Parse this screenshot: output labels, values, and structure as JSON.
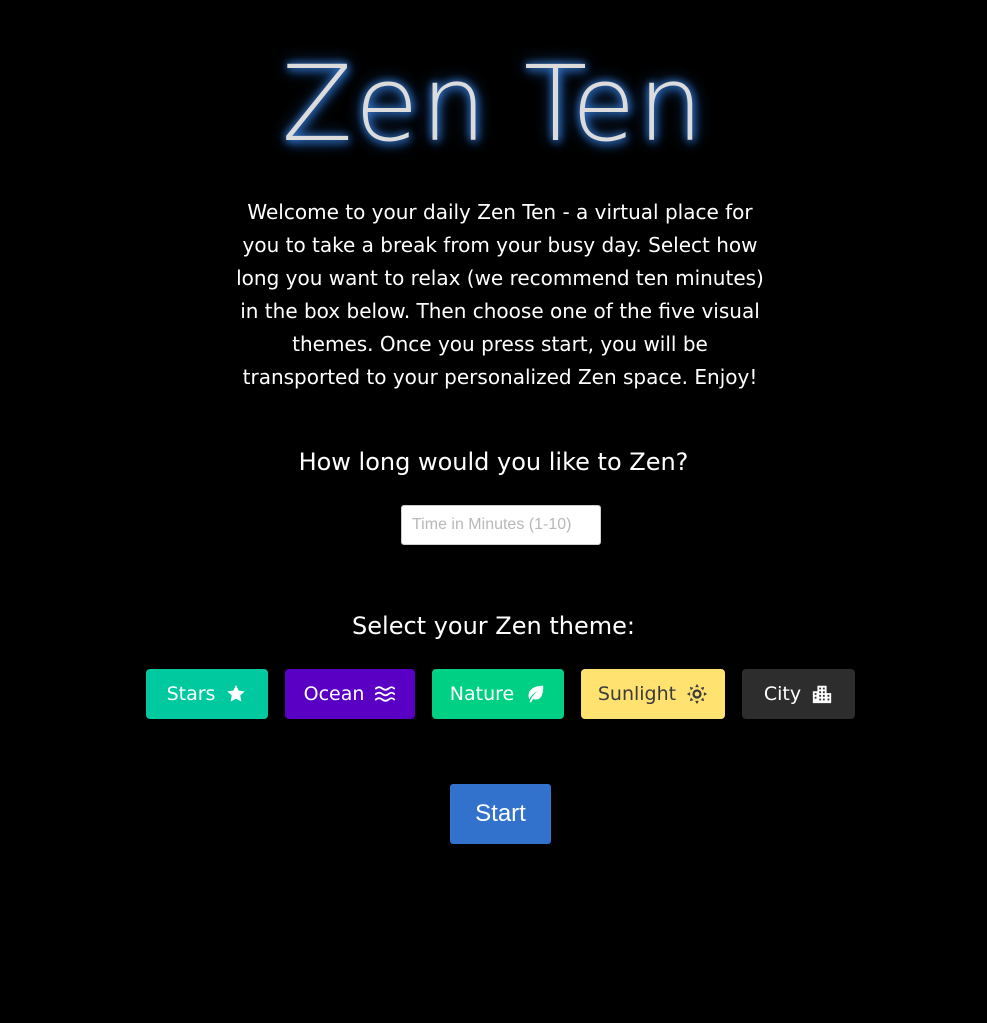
{
  "title": "Zen Ten",
  "intro": "Welcome to your daily Zen Ten - a virtual place for you to take a break from your busy day. Select how long you want to relax (we recommend ten minutes) in the box below. Then choose one of the five visual themes. Once you press start, you will be transported to your personalized Zen space. Enjoy!",
  "duration": {
    "question": "How long would you like to Zen?",
    "placeholder": "Time in Minutes (1-10)",
    "value": ""
  },
  "themes": {
    "heading": "Select your Zen theme:",
    "buttons": [
      {
        "label": "Stars",
        "icon": "star-icon",
        "color": "#00c9a0"
      },
      {
        "label": "Ocean",
        "icon": "water-icon",
        "color": "#5a00c4"
      },
      {
        "label": "Nature",
        "icon": "leaf-icon",
        "color": "#00d083"
      },
      {
        "label": "Sunlight",
        "icon": "sun-icon",
        "color": "#ffe270"
      },
      {
        "label": "City",
        "icon": "city-icon",
        "color": "#2d2d2d"
      }
    ]
  },
  "start": {
    "label": "Start",
    "color": "#3271cc"
  },
  "colors": {
    "background": "#000000",
    "title_glow": "#3d7fd6"
  }
}
